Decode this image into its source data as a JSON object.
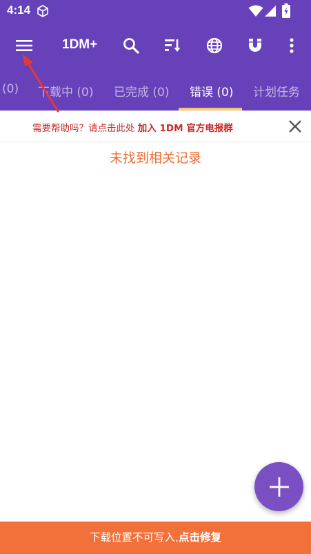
{
  "status_bar": {
    "time": "4:14",
    "left_icons": [
      "cube-icon"
    ],
    "right_icons": [
      "wifi-icon",
      "signal-icon",
      "battery-charging-icon"
    ]
  },
  "app_bar": {
    "title": "1DM+",
    "actions": [
      "menu-icon",
      "search-icon",
      "sort-icon",
      "globe-icon",
      "magnet-icon",
      "more-vert-icon"
    ]
  },
  "tabs": [
    {
      "label": "(0)",
      "active": false
    },
    {
      "label": "下载中 (0)",
      "active": false
    },
    {
      "label": "已完成 (0)",
      "active": false
    },
    {
      "label": "错误 (0)",
      "active": true
    },
    {
      "label": "计划任务",
      "active": false
    }
  ],
  "help_banner": {
    "prefix": "需要帮助吗？请点击此处 ",
    "link": "加入 1DM 官方电报群",
    "close_icon": "close-icon"
  },
  "empty_message": "未找到相关记录",
  "fab": {
    "icon": "add-icon"
  },
  "bottom_bar": {
    "prefix": "下载位置不可写入,",
    "action": "点击修复"
  },
  "annotation": {
    "icon": "red-arrow-icon",
    "color": "#e53935"
  },
  "colors": {
    "primary": "#6741b9",
    "tab_indicator": "#f5c97a",
    "help_text": "#c62828",
    "empty_text": "#f26b2e",
    "fab": "#7a4fc4",
    "bottom_bar": "#f2703a"
  }
}
